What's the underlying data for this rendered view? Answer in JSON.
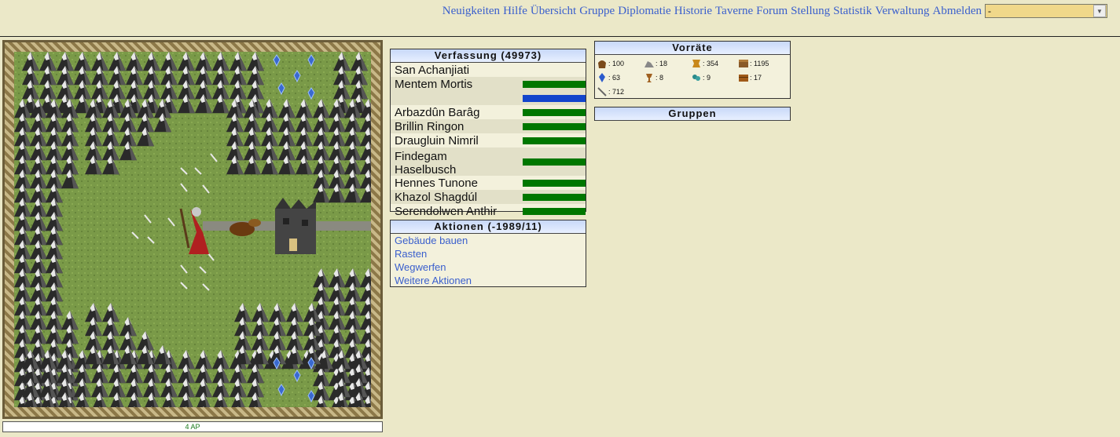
{
  "nav": {
    "links": [
      "Neuigkeiten",
      "Hilfe",
      "Übersicht",
      "Gruppe",
      "Diplomatie",
      "Historie",
      "Taverne",
      "Forum",
      "Stellung",
      "Statistik",
      "Verwaltung",
      "Abmelden"
    ],
    "select_value": "-"
  },
  "map": {
    "ap_label": "4 AP"
  },
  "verfassung": {
    "title": "Verfassung (49973)",
    "members": [
      {
        "name": "San Achanjiati",
        "status_color": "none"
      },
      {
        "name": "Mentem Mortis",
        "status_color": "#007700",
        "second_bar_color": "#1144cc"
      },
      {
        "name": "Arbazdûn Barâg",
        "status_color": "#007700"
      },
      {
        "name": "Brillin Ringon",
        "status_color": "#007700"
      },
      {
        "name": "Draugluin Nimril",
        "status_color": "#007700"
      },
      {
        "name": "Findegam Haselbusch",
        "status_color": "#007700"
      },
      {
        "name": "Hennes Tunone",
        "status_color": "#007700"
      },
      {
        "name": "Khazol Shagdúl",
        "status_color": "#007700"
      },
      {
        "name": "Serendolwen Anthir",
        "status_color": "#007700"
      }
    ],
    "findegam_line1": "Findegam",
    "findegam_line2": "Haselbusch"
  },
  "aktionen": {
    "title": "Aktionen (-1989/11)",
    "items": [
      "Gebäude bauen",
      "Rasten",
      "Wegwerfen",
      "Weitere Aktionen"
    ]
  },
  "vorraete": {
    "title": "Vorräte",
    "items": [
      {
        "icon": "sack-icon",
        "value": ": 100"
      },
      {
        "icon": "stone-icon",
        "value": ": 18"
      },
      {
        "icon": "pelt-icon",
        "value": ": 354"
      },
      {
        "icon": "wood-icon",
        "value": ": 1195"
      },
      {
        "icon": "crystal-icon",
        "value": ": 63"
      },
      {
        "icon": "chalice-icon",
        "value": ": 8"
      },
      {
        "icon": "herb-icon",
        "value": ": 9"
      },
      {
        "icon": "chest-icon",
        "value": ": 17"
      },
      {
        "icon": "bone-icon",
        "value": ": 712"
      }
    ]
  },
  "gruppen": {
    "title": "Gruppen"
  },
  "colors": {
    "link": "#3a5fcd",
    "bar_green": "#007700",
    "bar_blue": "#1144cc",
    "panel_header": "#c8d8f8",
    "background": "#ebe8c8"
  }
}
